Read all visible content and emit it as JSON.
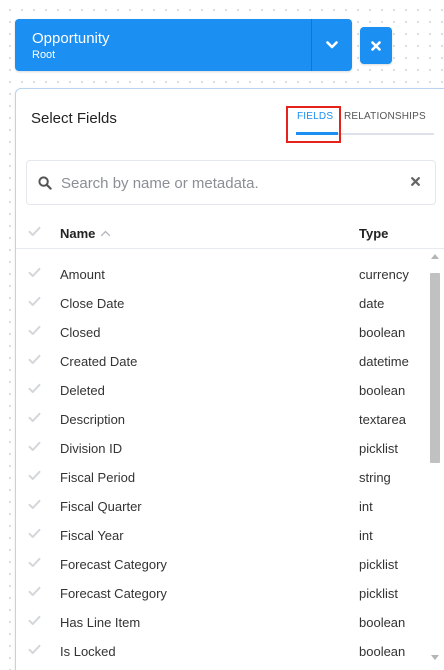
{
  "colors": {
    "accent": "#1b8ff2",
    "highlight_box": "#e3231c"
  },
  "object_selector": {
    "name": "Opportunity",
    "subtitle": "Root",
    "dropdown_icon": "chevron-down-icon",
    "close_icon": "close-icon"
  },
  "panel": {
    "title": "Select Fields",
    "tabs": [
      {
        "label": "FIELDS",
        "active": true
      },
      {
        "label": "RELATIONSHIPS",
        "active": false
      }
    ],
    "search": {
      "placeholder": "Search by name or metadata.",
      "value": ""
    },
    "columns": {
      "name": "Name",
      "type": "Type"
    },
    "rows": [
      {
        "name": "Amount",
        "type": "currency"
      },
      {
        "name": "Close Date",
        "type": "date"
      },
      {
        "name": "Closed",
        "type": "boolean"
      },
      {
        "name": "Created Date",
        "type": "datetime"
      },
      {
        "name": "Deleted",
        "type": "boolean"
      },
      {
        "name": "Description",
        "type": "textarea"
      },
      {
        "name": "Division ID",
        "type": "picklist"
      },
      {
        "name": "Fiscal Period",
        "type": "string"
      },
      {
        "name": "Fiscal Quarter",
        "type": "int"
      },
      {
        "name": "Fiscal Year",
        "type": "int"
      },
      {
        "name": "Forecast Category",
        "type": "picklist"
      },
      {
        "name": "Forecast Category",
        "type": "picklist"
      },
      {
        "name": "Has Line Item",
        "type": "boolean"
      },
      {
        "name": "Is Locked",
        "type": "boolean"
      }
    ]
  }
}
